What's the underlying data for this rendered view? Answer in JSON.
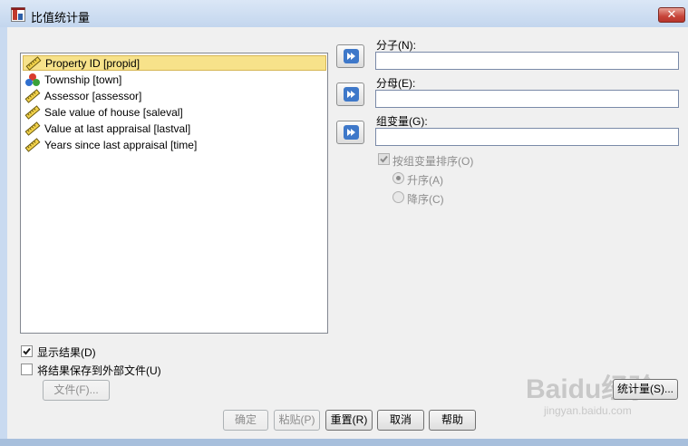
{
  "window": {
    "title": "比值统计量",
    "close_label": "✕"
  },
  "variables": [
    {
      "label": "Property ID [propid]",
      "icon": "ruler-icon",
      "selected": true
    },
    {
      "label": "Township [town]",
      "icon": "nominal-balls-icon",
      "selected": false
    },
    {
      "label": "Assessor [assessor]",
      "icon": "ruler-icon",
      "selected": false
    },
    {
      "label": "Sale value of house [saleval]",
      "icon": "ruler-icon",
      "selected": false
    },
    {
      "label": "Value at last appraisal [lastval]",
      "icon": "ruler-icon",
      "selected": false
    },
    {
      "label": "Years since last appraisal [time]",
      "icon": "ruler-icon",
      "selected": false
    }
  ],
  "fields": {
    "numerator_label": "分子(N):",
    "numerator_value": "",
    "denominator_label": "分母(E):",
    "denominator_value": "",
    "group_label": "组变量(G):",
    "group_value": ""
  },
  "sort": {
    "sort_by_group_label": "按组变量排序(O)",
    "ascending_label": "升序(A)",
    "descending_label": "降序(C)"
  },
  "output": {
    "display_results_label": "显示结果(D)",
    "save_to_file_label": "将结果保存到外部文件(U)",
    "file_button_label": "文件(F)..."
  },
  "buttons": {
    "statistics_label": "统计量(S)...",
    "ok_label": "确定",
    "paste_label": "粘贴(P)",
    "reset_label": "重置(R)",
    "cancel_label": "取消",
    "help_label": "帮助"
  },
  "watermark": {
    "brand": "Baidu经验",
    "url": "jingyan.baidu.com"
  }
}
